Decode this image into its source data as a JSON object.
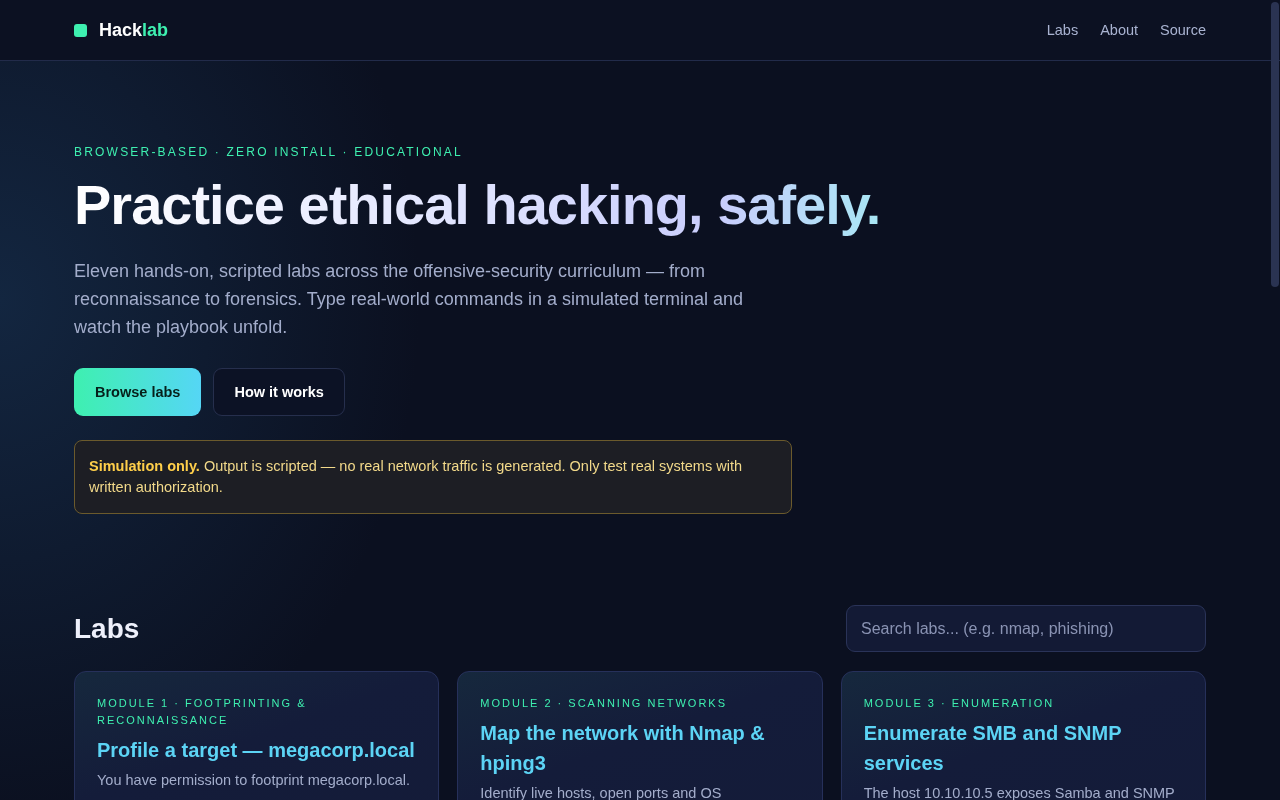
{
  "nav": {
    "brand": [
      "Hack",
      "lab"
    ],
    "links": [
      "Labs",
      "About",
      "Source"
    ]
  },
  "hero": {
    "eyebrow": "BROWSER-BASED · ZERO INSTALL · EDUCATIONAL",
    "title": [
      "Practice ethical hacking, ",
      "safely."
    ],
    "lead": "Eleven hands-on, scripted labs across the offensive-security curriculum — from reconnaissance to forensics. Type real-world commands in a simulated terminal and watch the playbook unfold.",
    "buttons": [
      {
        "label": "Browse labs",
        "kind": "primary"
      },
      {
        "label": "How it works",
        "kind": "secondary"
      }
    ],
    "notice": "**Simulation only.** Output is scripted — no real network traffic is generated. Only test real systems with written authorization."
  },
  "labs": {
    "heading": "Labs",
    "search": {
      "placeholder": "Search labs... (e.g. nmap, phishing)"
    },
    "cards": [
      {
        "module": "MODULE 1 · FOOTPRINTING & RECONNAISSANCE",
        "title": "Profile a target — megacorp.local",
        "description": "You have permission to footprint megacorp.local."
      },
      {
        "module": "MODULE 2 · SCANNING NETWORKS",
        "title": "Map the network with Nmap & hping3",
        "description": "Identify live hosts, open ports and OS"
      },
      {
        "module": "MODULE 3 · ENUMERATION",
        "title": "Enumerate SMB and SNMP services",
        "description": "The host 10.10.10.5 exposes Samba and SNMP"
      }
    ]
  }
}
